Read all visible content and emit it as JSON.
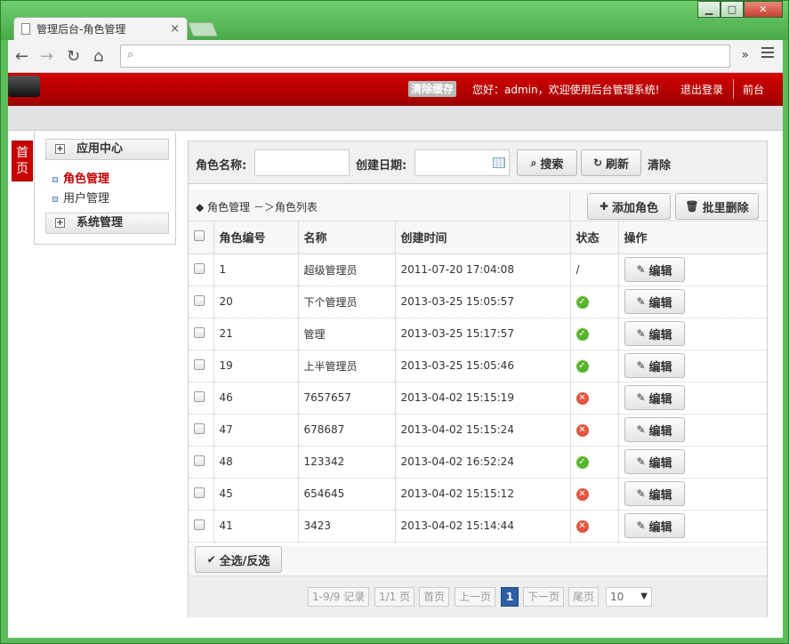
{
  "browser": {
    "tab_title": "管理后台-角色管理",
    "tab_close": "×",
    "address_value": "",
    "icons": [
      "back-icon",
      "forward-icon",
      "reload-icon",
      "home-icon",
      "search-icon",
      "menu-icon"
    ]
  },
  "header": {
    "clear_cache": "清除缓存",
    "greeting": "您好：admin，欢迎使用后台管理系统!",
    "logout": "退出登录",
    "front": "前台"
  },
  "home_tab": "首页",
  "sidebar": {
    "groups": [
      {
        "label": "应用中心",
        "items": [
          "角色管理",
          "用户管理"
        ]
      },
      {
        "label": "系统管理",
        "items": []
      }
    ],
    "active_item": "角色管理"
  },
  "search": {
    "role_name_label": "角色名称:",
    "role_name_value": "",
    "created_label": "创建日期:",
    "created_value": "",
    "search_btn": "搜索",
    "refresh_btn": "刷新",
    "clear": "清除"
  },
  "list": {
    "breadcrumb": "◆ 角色管理 －＞角色列表",
    "add_btn": "添加角色",
    "batch_delete_btn": "批里删除",
    "columns": [
      "角色编号",
      "名称",
      "创建时间",
      "状态",
      "操作"
    ],
    "rows": [
      {
        "id": "1",
        "name": "超级管理员",
        "created": "2011-07-20 17:04:08",
        "status": "/"
      },
      {
        "id": "20",
        "name": "下个管理员",
        "created": "2013-03-25 15:05:57",
        "status": "ok"
      },
      {
        "id": "21",
        "name": "管理",
        "created": "2013-03-25 15:17:57",
        "status": "ok"
      },
      {
        "id": "19",
        "name": "上半管理员",
        "created": "2013-03-25 15:05:46",
        "status": "ok"
      },
      {
        "id": "46",
        "name": "7657657",
        "created": "2013-04-02 15:15:19",
        "status": "no"
      },
      {
        "id": "47",
        "name": "678687",
        "created": "2013-04-02 15:15:24",
        "status": "no"
      },
      {
        "id": "48",
        "name": "123342",
        "created": "2013-04-02 16:52:24",
        "status": "ok"
      },
      {
        "id": "45",
        "name": "654645",
        "created": "2013-04-02 15:15:12",
        "status": "no"
      },
      {
        "id": "41",
        "name": "3423",
        "created": "2013-04-02 15:14:44",
        "status": "no"
      }
    ],
    "edit_label": "编辑",
    "select_all": "全选/反选"
  },
  "pager": {
    "records": "1-9/9 记录",
    "pages": "1/1 页",
    "first": "首页",
    "prev": "上一页",
    "current": "1",
    "next": "下一页",
    "last": "尾页",
    "page_size": "10"
  }
}
